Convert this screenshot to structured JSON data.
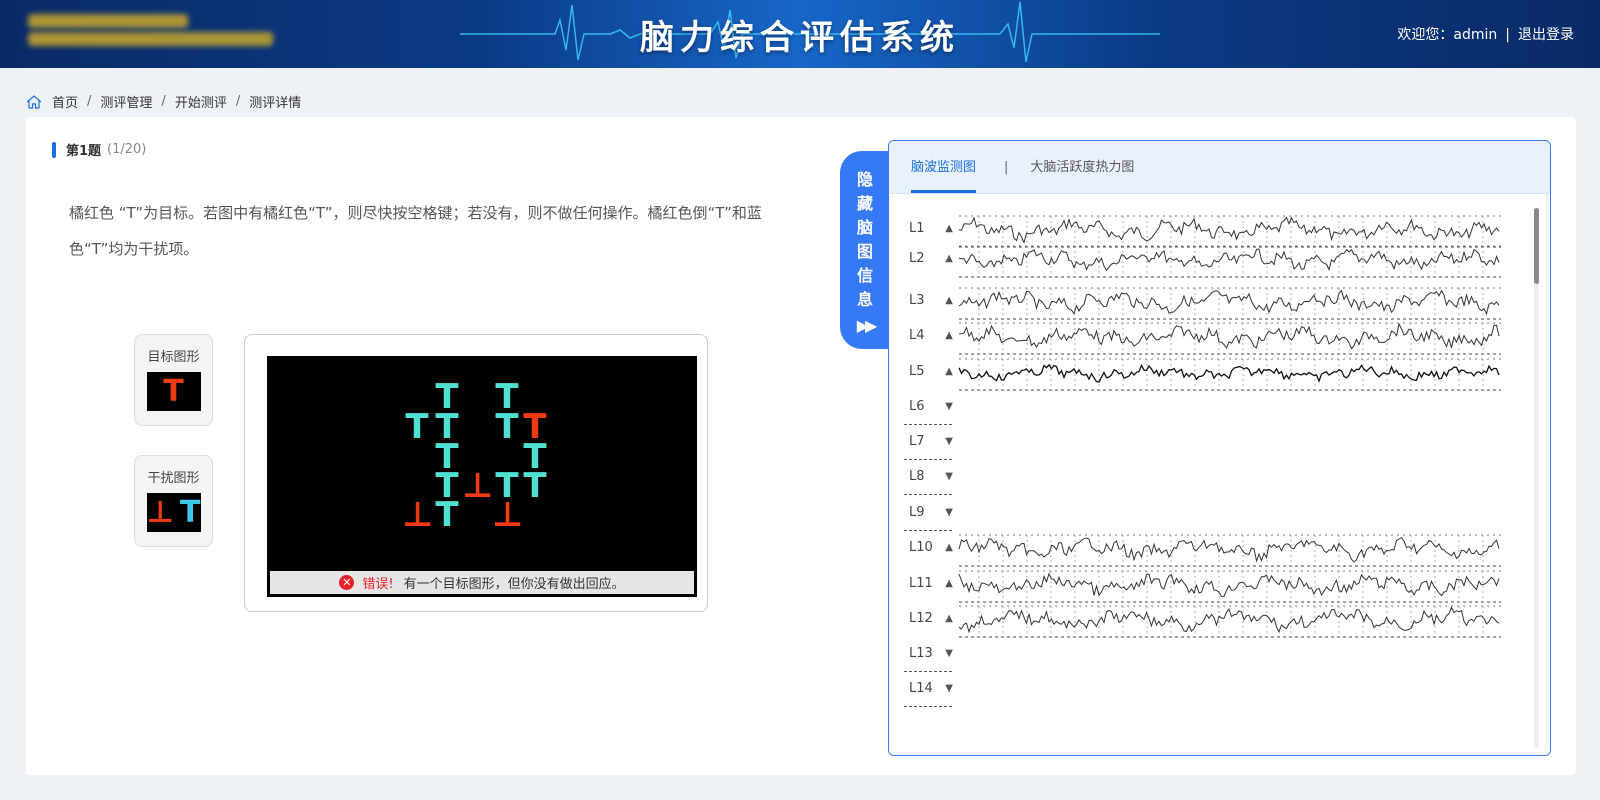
{
  "header": {
    "title": "脑力综合评估系统",
    "welcome": "欢迎您：admin",
    "logout": "退出登录"
  },
  "breadcrumb": [
    "首页",
    "测评管理",
    "开始测评",
    "测评详情"
  ],
  "question": {
    "title": "第1题",
    "count": "(1/20)",
    "text": "橘红色 “T”为目标。若图中有橘红色“T”，则尽快按空格键；若没有，则不做任何操作。橘红色倒“T”和蓝色“T”均为干扰项。"
  },
  "target_box": {
    "label": "目标图形",
    "symbol": "T",
    "color": "#f03a10"
  },
  "distract_box": {
    "label": "干扰图形",
    "symbols": [
      "⊥",
      "T"
    ],
    "colors": [
      "#f03a10",
      "#3ec7ec"
    ]
  },
  "stimulus": {
    "colors": {
      "cyan": "#50e0d2",
      "red": "#f03a10"
    },
    "items": [
      {
        "glyph": "T",
        "color": "cyan",
        "col": 2,
        "row": 0
      },
      {
        "glyph": "T",
        "color": "cyan",
        "col": 4,
        "row": 0
      },
      {
        "glyph": "T",
        "color": "cyan",
        "col": 1,
        "row": 1
      },
      {
        "glyph": "T",
        "color": "cyan",
        "col": 2,
        "row": 1
      },
      {
        "glyph": "T",
        "color": "cyan",
        "col": 4,
        "row": 1
      },
      {
        "glyph": "T",
        "color": "red",
        "col": 5,
        "row": 1
      },
      {
        "glyph": "T",
        "color": "cyan",
        "col": 2,
        "row": 2
      },
      {
        "glyph": "T",
        "color": "cyan",
        "col": 5,
        "row": 2
      },
      {
        "glyph": "T",
        "color": "cyan",
        "col": 2,
        "row": 3
      },
      {
        "glyph": "⊥",
        "color": "red",
        "col": 3,
        "row": 3
      },
      {
        "glyph": "T",
        "color": "cyan",
        "col": 4,
        "row": 3
      },
      {
        "glyph": "T",
        "color": "cyan",
        "col": 5,
        "row": 3
      },
      {
        "glyph": "⊥",
        "color": "red",
        "col": 1,
        "row": 4
      },
      {
        "glyph": "T",
        "color": "cyan",
        "col": 2,
        "row": 4
      },
      {
        "glyph": "⊥",
        "color": "red",
        "col": 4,
        "row": 4
      }
    ],
    "feedback": {
      "error_word": "错误!",
      "message": "有一个目标图形，但你没有做出回应。"
    }
  },
  "hide_tab": {
    "label": "隐藏脑图信息",
    "arrow": "▶▶"
  },
  "eeg": {
    "tabs": [
      "脑波监测图",
      "大脑活跃度热力图"
    ],
    "tab_separator": "|",
    "active_tab": 0,
    "channels": [
      {
        "name": "L1",
        "expanded": true
      },
      {
        "name": "L2",
        "expanded": true
      },
      {
        "name": "L3",
        "expanded": true
      },
      {
        "name": "L4",
        "expanded": true
      },
      {
        "name": "L5",
        "expanded": true
      },
      {
        "name": "L6",
        "expanded": false
      },
      {
        "name": "L7",
        "expanded": false
      },
      {
        "name": "L8",
        "expanded": false
      },
      {
        "name": "L9",
        "expanded": false
      },
      {
        "name": "L10",
        "expanded": true
      },
      {
        "name": "L11",
        "expanded": true
      },
      {
        "name": "L12",
        "expanded": true
      },
      {
        "name": "L13",
        "expanded": false
      },
      {
        "name": "L14",
        "expanded": false
      }
    ],
    "icons": {
      "expanded": "▲",
      "collapsed": "▼"
    }
  },
  "icons": {
    "home": "home-icon",
    "error": "error-icon",
    "expand": "expand-arrow-icon",
    "collapse": "collapse-arrow-icon"
  }
}
